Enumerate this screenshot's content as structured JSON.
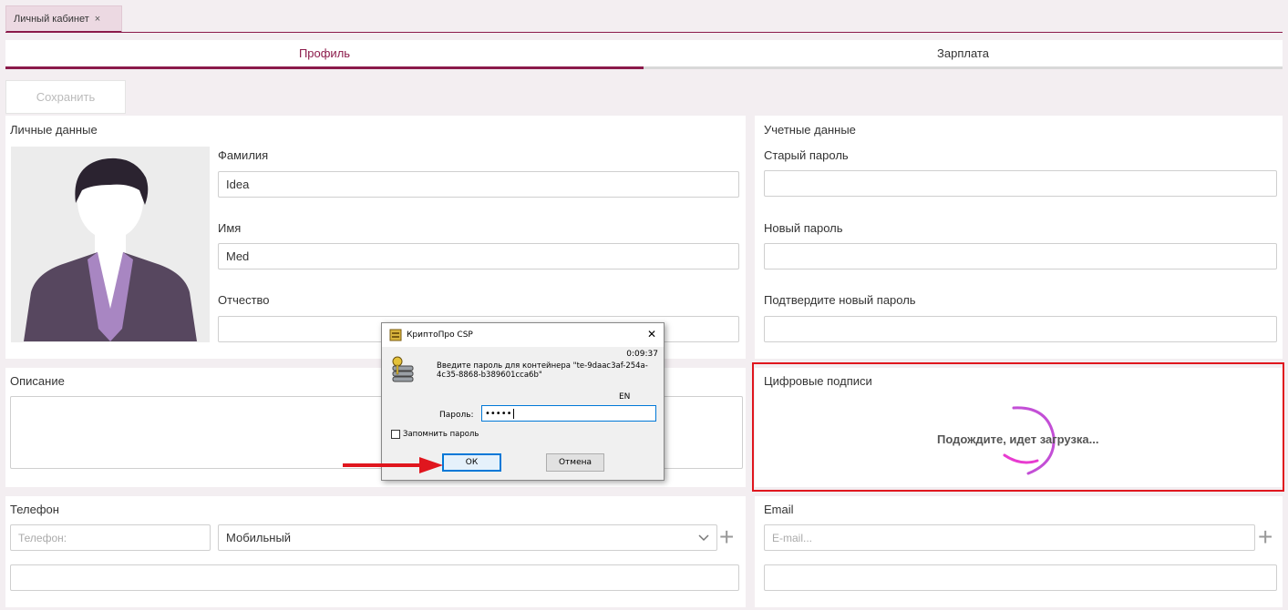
{
  "tabs": {
    "doc_tab_label": "Личный кабинет",
    "doc_tab_close": "×",
    "page_tabs": [
      {
        "label": "Профиль",
        "active": true
      },
      {
        "label": "Зарплата",
        "active": false
      }
    ]
  },
  "toolbar": {
    "save_label": "Сохранить"
  },
  "personal": {
    "title": "Личные данные",
    "surname_label": "Фамилия",
    "surname_value": "Idea",
    "name_label": "Имя",
    "name_value": "Med",
    "patronymic_label": "Отчество",
    "patronymic_value": ""
  },
  "description": {
    "title": "Описание",
    "value": ""
  },
  "account": {
    "title": "Учетные данные",
    "old_password_label": "Старый пароль",
    "new_password_label": "Новый пароль",
    "confirm_password_label": "Подтвердите новый пароль"
  },
  "signatures": {
    "title": "Цифровые подписи",
    "loading_text": "Подождите, идет загрузка..."
  },
  "phone": {
    "title": "Телефон",
    "placeholder": "Телефон:",
    "type_value": "Мобильный",
    "extra_value": ""
  },
  "email": {
    "title": "Email",
    "placeholder": "E-mail...",
    "extra_value": ""
  },
  "dialog": {
    "title": "КриптоПро CSP",
    "close": "✕",
    "timer": "0:09:37",
    "message": "Введите пароль для контейнера \"te-9daac3af-254a-4c35-8868-b389601cca6b\"",
    "lang": "EN",
    "password_label": "Пароль:",
    "password_value": "•••••",
    "remember_label": "Запомнить пароль",
    "ok_label": "ОК",
    "cancel_label": "Отмена"
  },
  "colors": {
    "accent": "#8b1a4a",
    "highlight": "#e0161e",
    "arrow": "#e0161e",
    "avatar_suit": "#57475f",
    "avatar_shirt": "#a886c2"
  }
}
